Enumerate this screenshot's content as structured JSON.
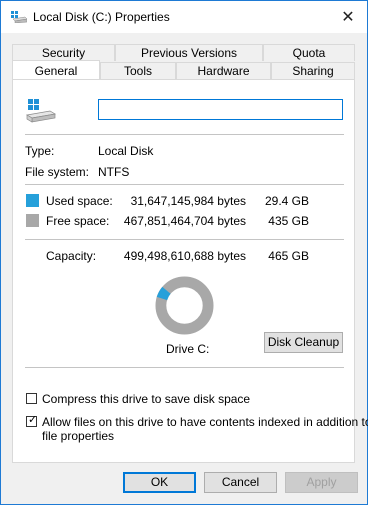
{
  "window": {
    "title": "Local Disk (C:) Properties"
  },
  "tabs": {
    "row1": [
      "Security",
      "Previous Versions",
      "Quota"
    ],
    "row2": [
      "General",
      "Tools",
      "Hardware",
      "Sharing"
    ],
    "active": "General"
  },
  "general": {
    "name_value": "",
    "type_label": "Type:",
    "type_value": "Local Disk",
    "fs_label": "File system:",
    "fs_value": "NTFS",
    "used": {
      "label": "Used space:",
      "bytes": "31,647,145,984 bytes",
      "size": "29.4 GB",
      "color": "#26a0da"
    },
    "free": {
      "label": "Free space:",
      "bytes": "467,851,464,704 bytes",
      "size": "435 GB",
      "color": "#a8a8a8"
    },
    "capacity": {
      "label": "Capacity:",
      "bytes": "499,498,610,688 bytes",
      "size": "465 GB"
    },
    "used_fraction": 0.0634,
    "drive_label": "Drive C:",
    "disk_cleanup_label": "Disk Cleanup",
    "compress_label": "Compress this drive to save disk space",
    "compress_checked": false,
    "index_label_line1": "Allow files on this drive to have contents indexed in addition to",
    "index_label_line2": "file properties",
    "index_checked": true
  },
  "buttons": {
    "ok": "OK",
    "cancel": "Cancel",
    "apply": "Apply"
  }
}
